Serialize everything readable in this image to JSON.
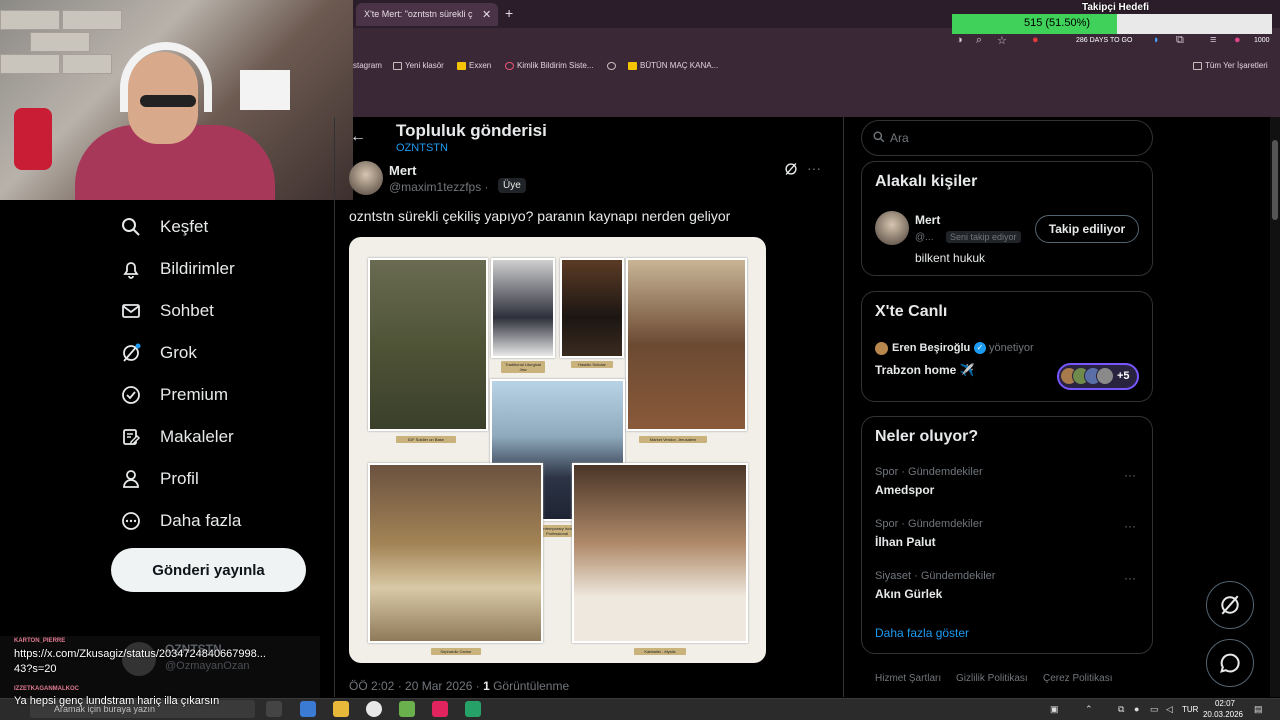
{
  "browser": {
    "tab_title": "X'te Mert: \"ozntstn sürekli ç",
    "tab_close": "✕",
    "new_tab": "+",
    "bookmarks": [
      "stagram",
      "Yeni klasör",
      "Exxen",
      "Kimlik Bildirim Siste...",
      "",
      "BÜTÜN MAÇ KANA..."
    ],
    "all_bookmarks": "Tüm Yer İşaretleri",
    "toolbar_badge": "286 DAYS TO GO",
    "toolbar_count": "1000"
  },
  "stream_overlay": {
    "goal_title": "Takipçi Hedefi",
    "goal_value": "515 (51.50%)",
    "goal_fraction": 0.515,
    "goal_color": "#3fd15a",
    "chat": [
      {
        "user": "KARTON_PIERRE",
        "message_line1": "https://x.com/Zkusagiz/status/20347248406679​98...",
        "message_line2": "43?s=20"
      },
      {
        "user": "IZZETKAGANMALKOC",
        "message_line1": "Ya hepsi genç lundstram hariç illa çıkarsın"
      }
    ],
    "mention_name": "OZNTSTN",
    "mention_handle": "@OzmayanOzan"
  },
  "nav": {
    "items": [
      {
        "label": "Keşfet",
        "icon": "search-icon"
      },
      {
        "label": "Bildirimler",
        "icon": "bell-icon"
      },
      {
        "label": "Sohbet",
        "icon": "mail-icon"
      },
      {
        "label": "Grok",
        "icon": "grok-icon"
      },
      {
        "label": "Premium",
        "icon": "verified-icon"
      },
      {
        "label": "Makaleler",
        "icon": "article-icon"
      },
      {
        "label": "Profil",
        "icon": "profile-icon"
      },
      {
        "label": "Daha fazla",
        "icon": "more-icon"
      }
    ],
    "post_button": "Gönderi yayınla"
  },
  "post": {
    "page_title": "Topluluk gönderisi",
    "community": "OZNTSTN",
    "author_name": "Mert",
    "author_handle": "@maxim1tezzfps · ",
    "member_badge": "Üye",
    "text": "ozntstn sürekli çekiliş yapıyo? paranın kaynapı nerden geliyor",
    "image_captions": [
      "IDF Soldier on Base",
      "Traditional Liturgical Jew",
      "Hasidic Scholar",
      "Market Vendor, Jerusalem",
      "Contemporary Israeli Professional",
      "Sephardic Cantor",
      "Kabbalist - Mystic"
    ],
    "meta_time": "ÖÖ 2:02 · 20 Mar 2026 · ",
    "meta_views_count": "1",
    "meta_views_label": " Görüntülenme"
  },
  "right": {
    "search_placeholder": "Ara",
    "relevant_title": "Alakalı kişiler",
    "relevant": {
      "name": "Mert",
      "handle": "@...",
      "follows_you": "Seni takip ediyor",
      "bio": "bilkent hukuk",
      "button": "Takip ediliyor"
    },
    "live_title": "X'te Canlı",
    "live": {
      "host": "Eren Beşiroğlu",
      "verified": "✓",
      "role": "yönetiyor",
      "topic": "Trabzon home ✈️",
      "plus": "+5"
    },
    "trends_title": "Neler oluyor?",
    "trends": [
      {
        "meta": "Spor · Gündemdekiler",
        "name": "Amedspor"
      },
      {
        "meta": "Spor · Gündemdekiler",
        "name": "İlhan Palut"
      },
      {
        "meta": "Siyaset · Gündemdekiler",
        "name": "Akın Gürlek"
      }
    ],
    "trend_more": "···",
    "show_more": "Daha fazla göster",
    "footer": [
      "Hizmet Şartları",
      "Gizlilik Politikası",
      "Çerez Politikası"
    ]
  },
  "taskbar": {
    "search": "Aramak için buraya yazın",
    "lang": "TUR",
    "time": "02:07",
    "date": "20.03.2026"
  },
  "colors": {
    "accent": "#1d9bf0",
    "bg": "#000000",
    "browser_bar": "#3a2837"
  }
}
